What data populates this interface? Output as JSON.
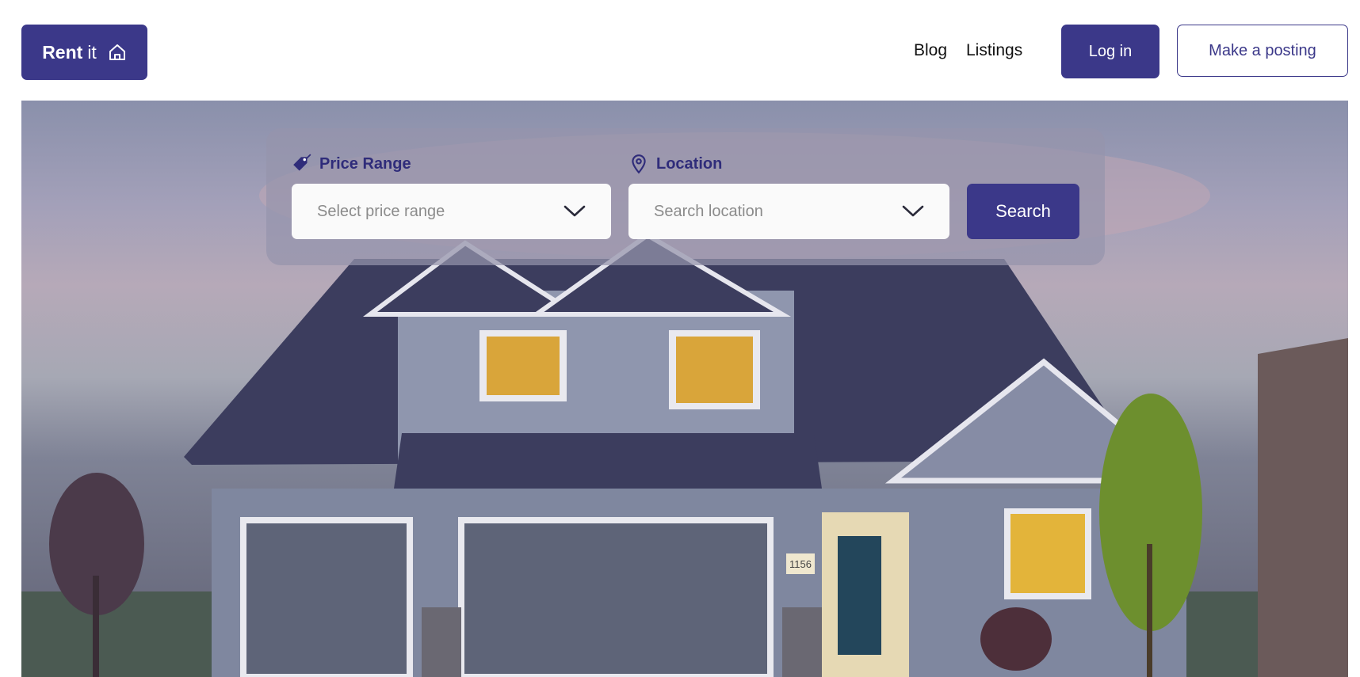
{
  "header": {
    "logo": {
      "strong": "Rent",
      "light": "it",
      "icon": "house-icon"
    },
    "nav": [
      {
        "label": "Blog"
      },
      {
        "label": "Listings"
      }
    ],
    "login_label": "Log in",
    "post_label": "Make  a posting"
  },
  "search": {
    "price": {
      "label": "Price Range",
      "icon": "price-tag-icon",
      "placeholder": "Select price range"
    },
    "location": {
      "label": "Location",
      "icon": "map-pin-icon",
      "placeholder": "Search location"
    },
    "button_label": "Search"
  },
  "hero": {
    "house_number": "1156"
  },
  "colors": {
    "brand": "#3b3889",
    "placeholder": "#8b8b8b",
    "panel": "#9694ac"
  }
}
